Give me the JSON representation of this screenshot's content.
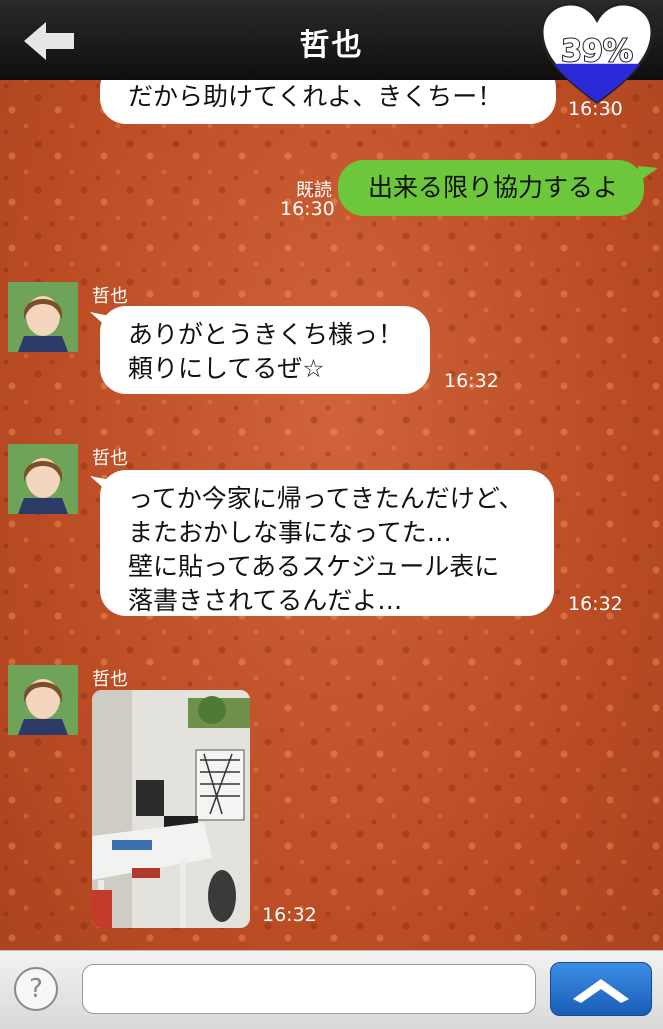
{
  "header": {
    "title": "哲也",
    "affection_percent": "39%",
    "affection_level": 0.39
  },
  "messages": [
    {
      "id": "m1",
      "side": "left",
      "text": "だから助けてくれよ、きくちー！",
      "time": "16:30"
    },
    {
      "id": "m2",
      "side": "right",
      "text": "出来る限り協力するよ",
      "read": "既読",
      "time": "16:30"
    },
    {
      "id": "m3",
      "side": "left",
      "sender": "哲也",
      "lines": [
        "ありがとうきくち様っ！",
        "頼りにしてるぜ☆"
      ],
      "time": "16:32"
    },
    {
      "id": "m4",
      "side": "left",
      "sender": "哲也",
      "lines": [
        "ってか今家に帰ってきたんだけど、",
        "またおかしな事になってた…",
        "壁に貼ってあるスケジュール表に",
        "落書きされてるんだよ…"
      ],
      "time": "16:32"
    },
    {
      "id": "m5",
      "side": "left",
      "sender": "哲也",
      "type": "photo",
      "time": "16:32"
    }
  ],
  "footer": {
    "help_label": "?",
    "input_value": "",
    "input_placeholder": ""
  },
  "colors": {
    "header_bg": "#111111",
    "chat_bg": "#c2532a",
    "own_bubble": "#6cc83a",
    "other_bubble": "#ffffff",
    "send_button": "#1f66c2"
  }
}
